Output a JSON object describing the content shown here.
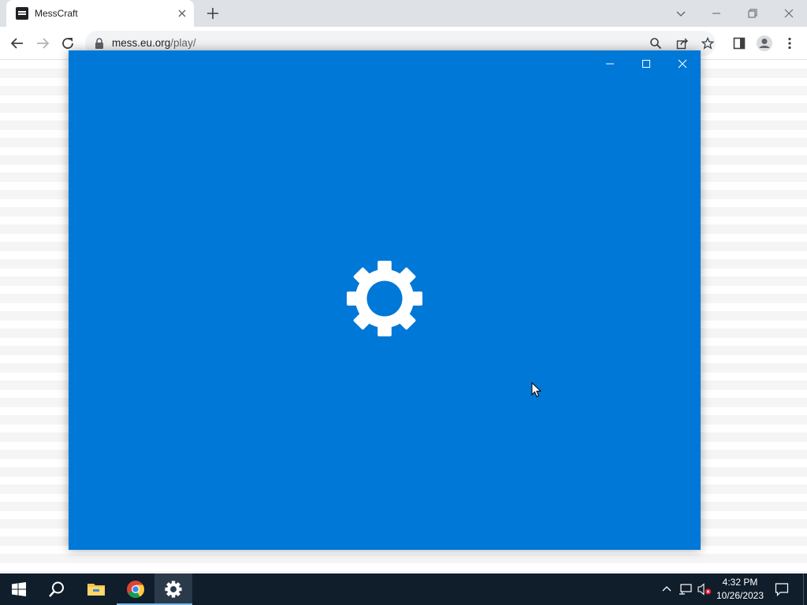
{
  "browser": {
    "tab_title": "MessCraft",
    "url_host": "mess.eu.org",
    "url_path": "/play/"
  },
  "app_window": {
    "background_color": "#0078d7",
    "splash_icon": "gear-icon"
  },
  "taskbar": {
    "time": "4:32 PM",
    "date": "10/26/2023",
    "pinned": [
      "start-icon",
      "search-icon",
      "file-explorer-icon",
      "chrome-icon",
      "settings-gear-icon"
    ]
  },
  "colors": {
    "taskbar": "#101d2b",
    "accent": "#0078d7"
  }
}
